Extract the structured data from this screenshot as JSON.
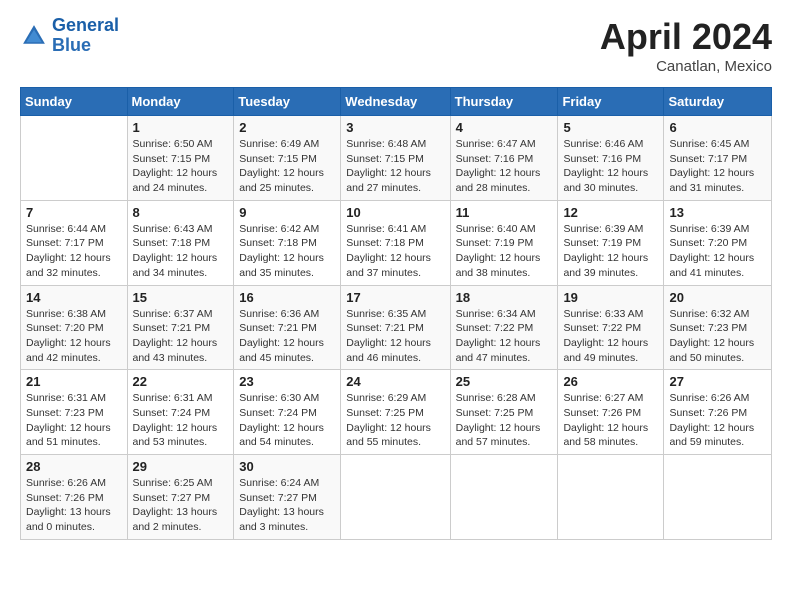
{
  "header": {
    "logo_line1": "General",
    "logo_line2": "Blue",
    "month": "April 2024",
    "location": "Canatlan, Mexico"
  },
  "days_of_week": [
    "Sunday",
    "Monday",
    "Tuesday",
    "Wednesday",
    "Thursday",
    "Friday",
    "Saturday"
  ],
  "weeks": [
    [
      {
        "num": "",
        "info": ""
      },
      {
        "num": "1",
        "info": "Sunrise: 6:50 AM\nSunset: 7:15 PM\nDaylight: 12 hours\nand 24 minutes."
      },
      {
        "num": "2",
        "info": "Sunrise: 6:49 AM\nSunset: 7:15 PM\nDaylight: 12 hours\nand 25 minutes."
      },
      {
        "num": "3",
        "info": "Sunrise: 6:48 AM\nSunset: 7:15 PM\nDaylight: 12 hours\nand 27 minutes."
      },
      {
        "num": "4",
        "info": "Sunrise: 6:47 AM\nSunset: 7:16 PM\nDaylight: 12 hours\nand 28 minutes."
      },
      {
        "num": "5",
        "info": "Sunrise: 6:46 AM\nSunset: 7:16 PM\nDaylight: 12 hours\nand 30 minutes."
      },
      {
        "num": "6",
        "info": "Sunrise: 6:45 AM\nSunset: 7:17 PM\nDaylight: 12 hours\nand 31 minutes."
      }
    ],
    [
      {
        "num": "7",
        "info": "Sunrise: 6:44 AM\nSunset: 7:17 PM\nDaylight: 12 hours\nand 32 minutes."
      },
      {
        "num": "8",
        "info": "Sunrise: 6:43 AM\nSunset: 7:18 PM\nDaylight: 12 hours\nand 34 minutes."
      },
      {
        "num": "9",
        "info": "Sunrise: 6:42 AM\nSunset: 7:18 PM\nDaylight: 12 hours\nand 35 minutes."
      },
      {
        "num": "10",
        "info": "Sunrise: 6:41 AM\nSunset: 7:18 PM\nDaylight: 12 hours\nand 37 minutes."
      },
      {
        "num": "11",
        "info": "Sunrise: 6:40 AM\nSunset: 7:19 PM\nDaylight: 12 hours\nand 38 minutes."
      },
      {
        "num": "12",
        "info": "Sunrise: 6:39 AM\nSunset: 7:19 PM\nDaylight: 12 hours\nand 39 minutes."
      },
      {
        "num": "13",
        "info": "Sunrise: 6:39 AM\nSunset: 7:20 PM\nDaylight: 12 hours\nand 41 minutes."
      }
    ],
    [
      {
        "num": "14",
        "info": "Sunrise: 6:38 AM\nSunset: 7:20 PM\nDaylight: 12 hours\nand 42 minutes."
      },
      {
        "num": "15",
        "info": "Sunrise: 6:37 AM\nSunset: 7:21 PM\nDaylight: 12 hours\nand 43 minutes."
      },
      {
        "num": "16",
        "info": "Sunrise: 6:36 AM\nSunset: 7:21 PM\nDaylight: 12 hours\nand 45 minutes."
      },
      {
        "num": "17",
        "info": "Sunrise: 6:35 AM\nSunset: 7:21 PM\nDaylight: 12 hours\nand 46 minutes."
      },
      {
        "num": "18",
        "info": "Sunrise: 6:34 AM\nSunset: 7:22 PM\nDaylight: 12 hours\nand 47 minutes."
      },
      {
        "num": "19",
        "info": "Sunrise: 6:33 AM\nSunset: 7:22 PM\nDaylight: 12 hours\nand 49 minutes."
      },
      {
        "num": "20",
        "info": "Sunrise: 6:32 AM\nSunset: 7:23 PM\nDaylight: 12 hours\nand 50 minutes."
      }
    ],
    [
      {
        "num": "21",
        "info": "Sunrise: 6:31 AM\nSunset: 7:23 PM\nDaylight: 12 hours\nand 51 minutes."
      },
      {
        "num": "22",
        "info": "Sunrise: 6:31 AM\nSunset: 7:24 PM\nDaylight: 12 hours\nand 53 minutes."
      },
      {
        "num": "23",
        "info": "Sunrise: 6:30 AM\nSunset: 7:24 PM\nDaylight: 12 hours\nand 54 minutes."
      },
      {
        "num": "24",
        "info": "Sunrise: 6:29 AM\nSunset: 7:25 PM\nDaylight: 12 hours\nand 55 minutes."
      },
      {
        "num": "25",
        "info": "Sunrise: 6:28 AM\nSunset: 7:25 PM\nDaylight: 12 hours\nand 57 minutes."
      },
      {
        "num": "26",
        "info": "Sunrise: 6:27 AM\nSunset: 7:26 PM\nDaylight: 12 hours\nand 58 minutes."
      },
      {
        "num": "27",
        "info": "Sunrise: 6:26 AM\nSunset: 7:26 PM\nDaylight: 12 hours\nand 59 minutes."
      }
    ],
    [
      {
        "num": "28",
        "info": "Sunrise: 6:26 AM\nSunset: 7:26 PM\nDaylight: 13 hours\nand 0 minutes."
      },
      {
        "num": "29",
        "info": "Sunrise: 6:25 AM\nSunset: 7:27 PM\nDaylight: 13 hours\nand 2 minutes."
      },
      {
        "num": "30",
        "info": "Sunrise: 6:24 AM\nSunset: 7:27 PM\nDaylight: 13 hours\nand 3 minutes."
      },
      {
        "num": "",
        "info": ""
      },
      {
        "num": "",
        "info": ""
      },
      {
        "num": "",
        "info": ""
      },
      {
        "num": "",
        "info": ""
      }
    ]
  ]
}
